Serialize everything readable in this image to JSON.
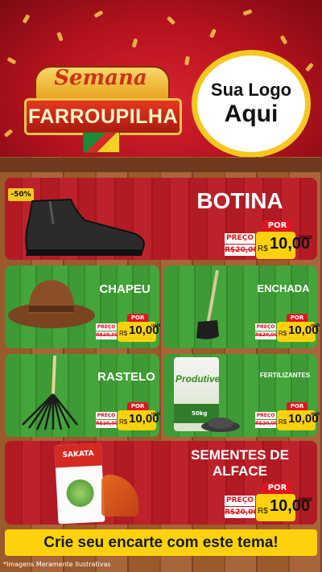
{
  "header": {
    "campaign_line1": "Semana",
    "campaign_line2": "FARROUPILHA",
    "logo_line1": "Sua Logo",
    "logo_line2": "Aqui"
  },
  "products": {
    "botina": {
      "name": "BOTINA",
      "discount": "-50%",
      "preco_label": "PREÇO",
      "old_price": "R$20,00",
      "por": "POR",
      "currency": "R$",
      "price": "10,00",
      "unit": "UNID"
    },
    "chapeu": {
      "name": "CHAPEU",
      "preco_label": "PREÇO",
      "old_price": "R$20,00",
      "por": "POR",
      "currency": "R$",
      "price": "10,00",
      "unit": "UNID"
    },
    "enchada": {
      "name": "ENCHADA",
      "preco_label": "PREÇO",
      "old_price": "R$20,00",
      "por": "POR",
      "currency": "R$",
      "price": "10,00",
      "unit": "UNID"
    },
    "rastelo": {
      "name": "RASTELO",
      "preco_label": "PREÇO",
      "old_price": "R$20,00",
      "por": "POR",
      "currency": "R$",
      "price": "10,00",
      "unit": "UNID"
    },
    "fertilizantes": {
      "name": "FERTILIZANTES",
      "bag_brand": "Produtive",
      "bag_weight": "50kg",
      "preco_label": "PREÇO",
      "old_price": "R$20,00",
      "por": "POR",
      "currency": "R$",
      "price": "10,00",
      "unit": "UNID"
    },
    "sementes": {
      "name_line1": "SEMENTES DE",
      "name_line2": "ALFACE",
      "pack_brand": "SAKATA",
      "preco_label": "PREÇO",
      "old_price": "R$20,00",
      "por": "POR",
      "currency": "R$",
      "price": "10,00",
      "unit": "UNID"
    }
  },
  "banner": {
    "text": "Crie seu encarte com este tema!"
  },
  "footnote": {
    "text": "*Imagens Meramente Ilustrativas"
  },
  "colors": {
    "red": "#b21b24",
    "green": "#3d9a34",
    "yellow": "#fdd20d",
    "price_red": "#e3141f"
  }
}
